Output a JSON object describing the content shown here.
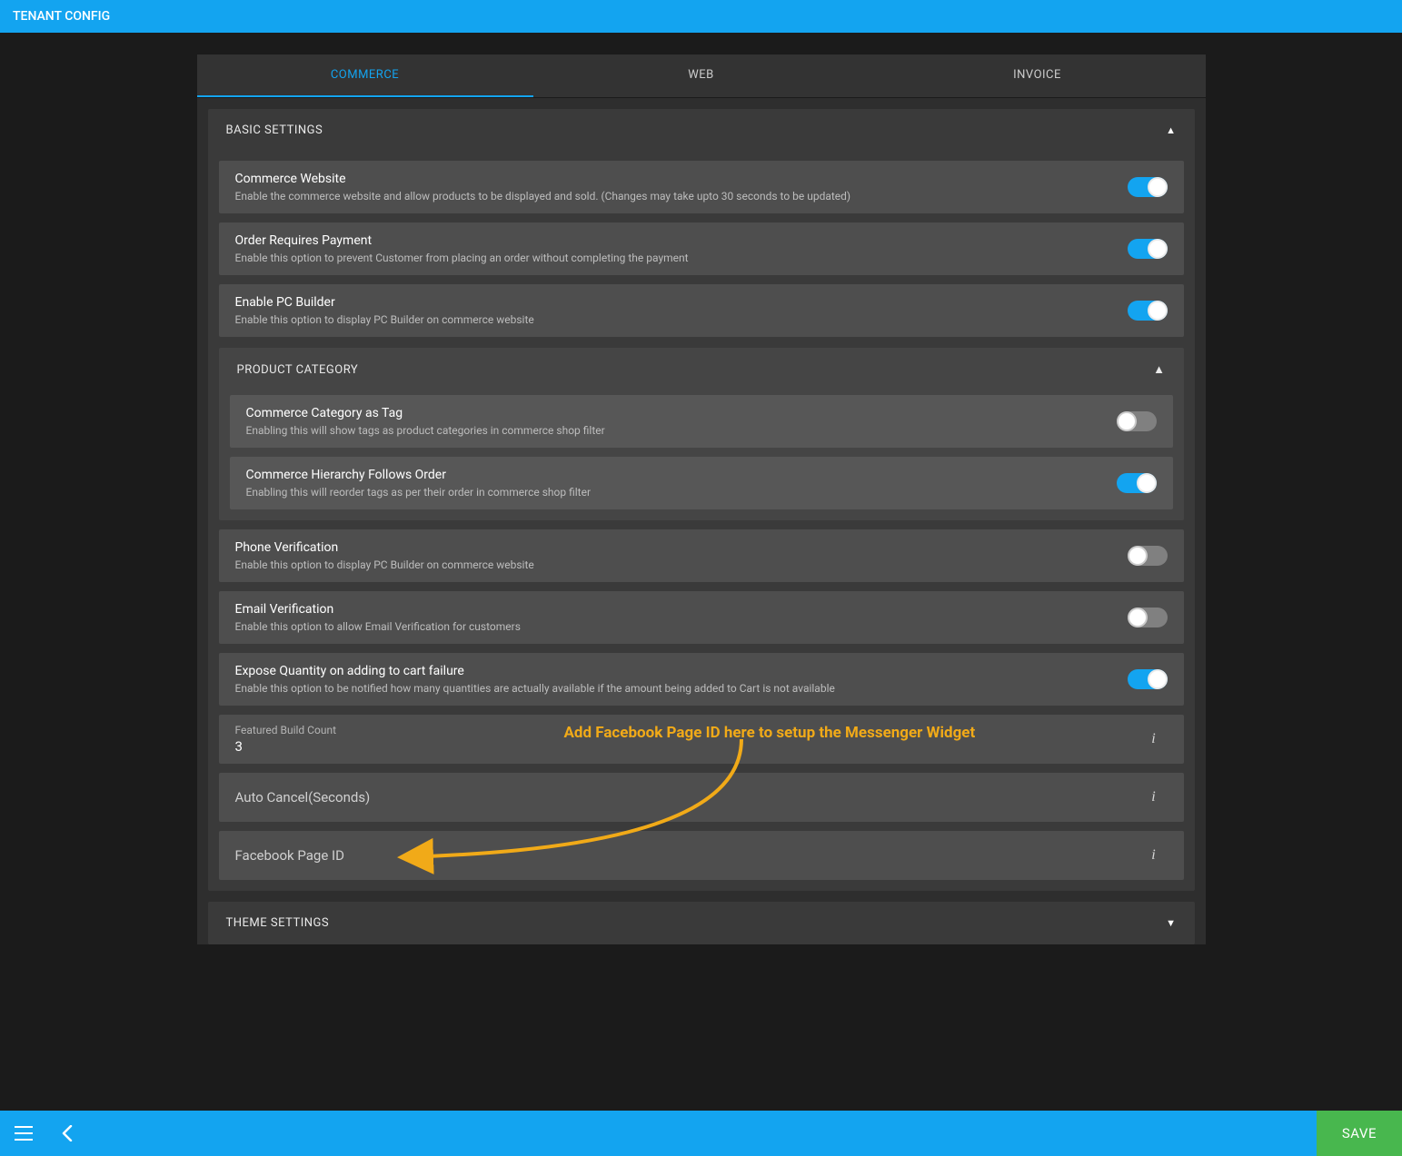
{
  "topbar": {
    "title": "TENANT CONFIG"
  },
  "tabs": [
    "COMMERCE",
    "WEB",
    "INVOICE"
  ],
  "active_tab": 0,
  "sections": {
    "basic": {
      "title": "BASIC SETTINGS",
      "rows": [
        {
          "title": "Commerce Website",
          "desc": "Enable the commerce website and allow products to be displayed and sold. (Changes may take upto 30 seconds to be updated)",
          "on": true
        },
        {
          "title": "Order Requires Payment",
          "desc": "Enable this option to prevent Customer from placing an order without completing the payment",
          "on": true
        },
        {
          "title": "Enable PC Builder",
          "desc": "Enable this option to display PC Builder on commerce website",
          "on": true
        }
      ],
      "product_category": {
        "title": "PRODUCT CATEGORY",
        "rows": [
          {
            "title": "Commerce Category as Tag",
            "desc": "Enabling this will show tags as product categories in commerce shop filter",
            "on": false
          },
          {
            "title": "Commerce Hierarchy Follows Order",
            "desc": "Enabling this will reorder tags as per their order in commerce shop filter",
            "on": true
          }
        ]
      },
      "more_rows": [
        {
          "title": "Phone Verification",
          "desc": "Enable this option to display PC Builder on commerce website",
          "on": false
        },
        {
          "title": "Email Verification",
          "desc": "Enable this option to allow Email Verification for customers",
          "on": false
        },
        {
          "title": "Expose Quantity on adding to cart failure",
          "desc": "Enable this option to be notified how many quantities are actually available if the amount being added to Cart is not available",
          "on": true
        }
      ],
      "inputs": [
        {
          "label": "Featured Build Count",
          "value": "3",
          "has_value": true
        },
        {
          "label": "Auto Cancel(Seconds)",
          "value": "",
          "has_value": false
        },
        {
          "label": "Facebook Page ID",
          "value": "",
          "has_value": false
        }
      ]
    },
    "theme": {
      "title": "THEME SETTINGS"
    }
  },
  "annotation": {
    "text": "Add Facebook Page ID here to setup the Messenger Widget"
  },
  "bottombar": {
    "save": "SAVE"
  }
}
